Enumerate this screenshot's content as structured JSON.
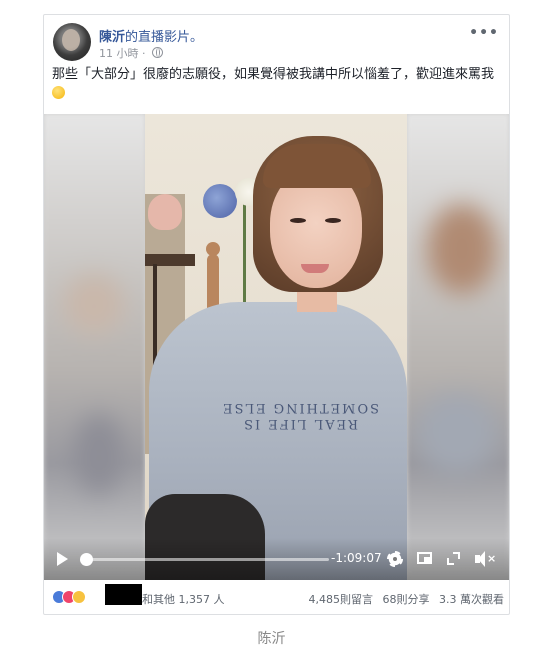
{
  "post": {
    "page_name": "陳沂",
    "page_suffix": "的直播影片。",
    "time": "11 小時 ·",
    "more": "•••",
    "caption_text": "那些「大部分」很廢的志願役，如果覺得被我講中所以惱羞了，歡迎進來罵我"
  },
  "video": {
    "shirt_text": "REAL LIFE IS SOMETHING ELSE",
    "time_remaining": "-1:09:07",
    "progress": 0.01
  },
  "footer": {
    "reactions_text": "和其他 1,357 人",
    "comments": "4,485則留言",
    "shares": "68則分享",
    "views": "3.3 萬次觀看"
  },
  "figure_caption": "陈沂",
  "colors": {
    "link": "#365899",
    "like": "#4a7bd9",
    "love": "#f0446a",
    "haha": "#f7c23f"
  },
  "icons": [
    "avatar",
    "globe-icon",
    "more-icon",
    "kissing-emoji-icon",
    "play-icon",
    "gear-icon",
    "pip-icon",
    "fullscreen-icon",
    "volume-icon",
    "like-icon",
    "love-icon",
    "haha-icon"
  ]
}
